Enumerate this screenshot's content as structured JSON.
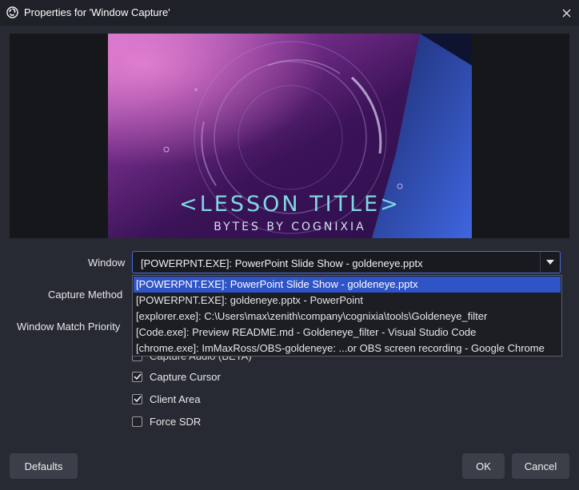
{
  "window": {
    "title": "Properties for 'Window Capture'"
  },
  "preview": {
    "slide_title": "<LESSON TITLE>",
    "slide_subtitle": "BYTES BY COGNIXIA"
  },
  "form": {
    "window_label": "Window",
    "window_value": "[POWERPNT.EXE]: PowerPoint Slide Show  -  goldeneye.pptx",
    "capture_method_label": "Capture Method",
    "window_match_priority_label": "Window Match Priority",
    "window_options": [
      "[POWERPNT.EXE]: PowerPoint Slide Show  -  goldeneye.pptx",
      "[POWERPNT.EXE]: goldeneye.pptx - PowerPoint",
      "[explorer.exe]: C:\\Users\\max\\zenith\\company\\cognixia\\tools\\Goldeneye_filter",
      "[Code.exe]: Preview README.md - Goldeneye_filter - Visual Studio Code",
      "[chrome.exe]: ImMaxRoss/OBS-goldeneye: ...or OBS screen recording - Google Chrome"
    ],
    "selected_option_index": 0,
    "capture_audio_label": "Capture Audio (BETA)",
    "capture_cursor_label": "Capture Cursor",
    "capture_cursor_checked": true,
    "client_area_label": "Client Area",
    "client_area_checked": true,
    "force_sdr_label": "Force SDR",
    "force_sdr_checked": false
  },
  "buttons": {
    "defaults": "Defaults",
    "ok": "OK",
    "cancel": "Cancel"
  },
  "colors": {
    "accent": "#2f54c8",
    "background": "#272a33",
    "slide_title": "#7fd7e2"
  }
}
